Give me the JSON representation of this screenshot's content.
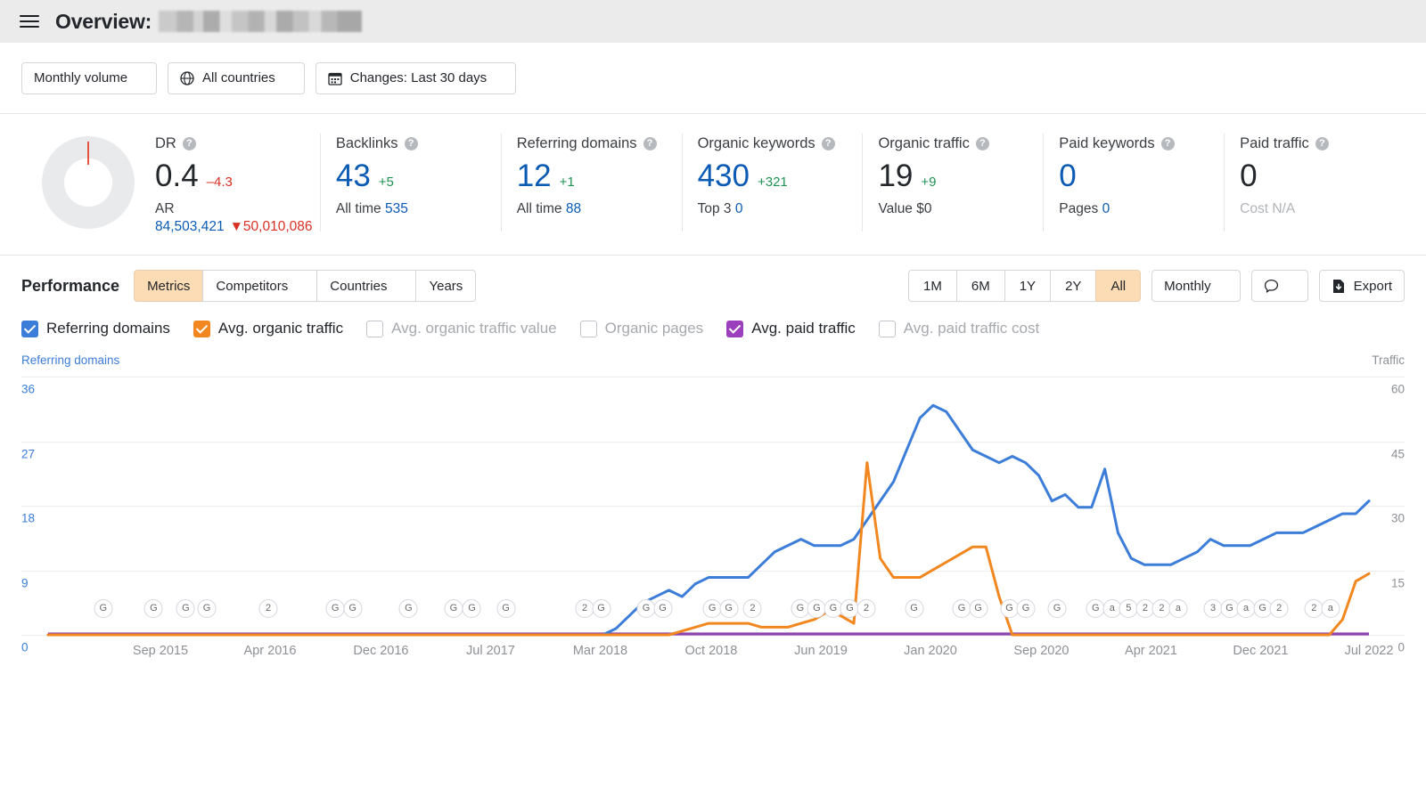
{
  "header": {
    "menu_icon": "hamburger-icon",
    "title": "Overview:",
    "domain_blurred": ""
  },
  "filters": [
    {
      "label": "Monthly volume",
      "icon": ""
    },
    {
      "label": "All countries",
      "icon": "globe-icon"
    },
    {
      "label": "Changes: Last 30 days",
      "icon": "calendar-icon"
    }
  ],
  "metrics": {
    "dr": {
      "label": "DR",
      "value": "0.4",
      "delta": "–4.3",
      "delta_dir": "down",
      "sub_label": "AR",
      "ar_value": "84,503,421",
      "ar_delta": "50,010,086",
      "ar_delta_dir": "down"
    },
    "backlinks": {
      "label": "Backlinks",
      "value": "43",
      "delta": "+5",
      "delta_dir": "up",
      "sub_label": "All time",
      "sub_value": "535"
    },
    "referring_domains": {
      "label": "Referring domains",
      "value": "12",
      "delta": "+1",
      "delta_dir": "up",
      "sub_label": "All time",
      "sub_value": "88"
    },
    "organic_keywords": {
      "label": "Organic keywords",
      "value": "430",
      "delta": "+321",
      "delta_dir": "up",
      "sub_label": "Top 3",
      "sub_value": "0"
    },
    "organic_traffic": {
      "label": "Organic traffic",
      "value": "19",
      "delta": "+9",
      "delta_dir": "up",
      "sub_label": "Value",
      "sub_value": "$0"
    },
    "paid_keywords": {
      "label": "Paid keywords",
      "value": "0",
      "delta": "",
      "sub_label": "Pages",
      "sub_value": "0"
    },
    "paid_traffic": {
      "label": "Paid traffic",
      "value": "0",
      "delta": "",
      "sub_label": "Cost",
      "sub_value": "N/A"
    },
    "help_icon": "question-mark-icon"
  },
  "performance": {
    "title": "Performance",
    "tabs": [
      {
        "label": "Metrics",
        "active": true,
        "caret": false
      },
      {
        "label": "Competitors",
        "active": false,
        "caret": true
      },
      {
        "label": "Countries",
        "active": false,
        "caret": true
      },
      {
        "label": "Years",
        "active": false,
        "caret": false
      }
    ],
    "ranges": [
      {
        "label": "1M",
        "active": false
      },
      {
        "label": "6M",
        "active": false
      },
      {
        "label": "1Y",
        "active": false
      },
      {
        "label": "2Y",
        "active": false
      },
      {
        "label": "All",
        "active": true
      }
    ],
    "granularity": "Monthly",
    "annotations_icon": "speech-bubble-icon",
    "export_label": "Export",
    "export_icon": "download-icon"
  },
  "legend": [
    {
      "label": "Referring domains",
      "checked": true,
      "color": "#3b7dd8"
    },
    {
      "label": "Avg. organic traffic",
      "checked": true,
      "color": "#f2871f"
    },
    {
      "label": "Avg. organic traffic value",
      "checked": false,
      "color": ""
    },
    {
      "label": "Organic pages",
      "checked": false,
      "color": ""
    },
    {
      "label": "Avg. paid traffic",
      "checked": true,
      "color": "#9c3fbd"
    },
    {
      "label": "Avg. paid traffic cost",
      "checked": false,
      "color": ""
    }
  ],
  "chart_data": {
    "type": "line",
    "title": "",
    "left_axis_title": "Referring domains",
    "right_axis_title": "Traffic",
    "left_ticks": [
      "36",
      "27",
      "18",
      "9",
      "0"
    ],
    "right_ticks": [
      "60",
      "45",
      "30",
      "15",
      "0"
    ],
    "left_ylim": [
      0,
      40.5
    ],
    "right_ylim": [
      0,
      67.5
    ],
    "grid": true,
    "legend_position": "top",
    "xlabels": [
      "Sep 2015",
      "Apr 2016",
      "Dec 2016",
      "Jul 2017",
      "Mar 2018",
      "Oct 2018",
      "Jun 2019",
      "Jan 2020",
      "Sep 2020",
      "Apr 2021",
      "Dec 2021",
      "Jul 2022"
    ],
    "xlabel_positions": [
      8.5,
      16.8,
      25.2,
      33.5,
      41.8,
      50.2,
      58.5,
      66.8,
      75.2,
      83.5,
      91.8,
      100.0
    ],
    "series": [
      {
        "name": "Referring domains",
        "color": "#3b7dd8",
        "axis": "left",
        "values": [
          0,
          0,
          0,
          0,
          0,
          0,
          0,
          0,
          0,
          0,
          0,
          0,
          0,
          0,
          0,
          0,
          0,
          0,
          0,
          0,
          0,
          0,
          0,
          0,
          0,
          0,
          0,
          0,
          0,
          0,
          0,
          0,
          0,
          0,
          0,
          0,
          0,
          0,
          0,
          0,
          0,
          0,
          0,
          1,
          3,
          5,
          6,
          7,
          6,
          8,
          9,
          9,
          9,
          9,
          11,
          13,
          14,
          15,
          14,
          14,
          14,
          15,
          18,
          21,
          24,
          29,
          34,
          36,
          35,
          32,
          29,
          28,
          27,
          28,
          27,
          25,
          21,
          22,
          20,
          20,
          26,
          16,
          12,
          11,
          11,
          11,
          12,
          13,
          15,
          14,
          14,
          14,
          15,
          16,
          16,
          16,
          17,
          18,
          19,
          19,
          21
        ]
      },
      {
        "name": "Avg. organic traffic",
        "color": "#f2871f",
        "axis": "right",
        "values": [
          0,
          0,
          0,
          0,
          0,
          0,
          0,
          0,
          0,
          0,
          0,
          0,
          0,
          0,
          0,
          0,
          0,
          0,
          0,
          0,
          0,
          0,
          0,
          0,
          0,
          0,
          0,
          0,
          0,
          0,
          0,
          0,
          0,
          0,
          0,
          0,
          0,
          0,
          0,
          0,
          0,
          0,
          0,
          0,
          0,
          0,
          0,
          0,
          1,
          2,
          3,
          3,
          3,
          3,
          2,
          2,
          2,
          3,
          4,
          6,
          5,
          3,
          45,
          20,
          15,
          15,
          15,
          17,
          19,
          21,
          23,
          23,
          10,
          0,
          0,
          0,
          0,
          0,
          0,
          0,
          0,
          0,
          0,
          0,
          0,
          0,
          0,
          0,
          0,
          0,
          0,
          0,
          0,
          0,
          0,
          0,
          0,
          0,
          4,
          14,
          16
        ]
      },
      {
        "name": "Avg. paid traffic",
        "color": "#9c3fbd",
        "axis": "right",
        "values": [
          0,
          0,
          0,
          0,
          0,
          0,
          0,
          0,
          0,
          0,
          0,
          0,
          0,
          0,
          0,
          0,
          0,
          0,
          0,
          0,
          0,
          0,
          0,
          0,
          0,
          0,
          0,
          0,
          0,
          0,
          0,
          0,
          0,
          0,
          0,
          0,
          0,
          0,
          0,
          0,
          0,
          0,
          0,
          0,
          0,
          0,
          0,
          0,
          0,
          0,
          0,
          0,
          0,
          0,
          0,
          0,
          0,
          0,
          0,
          0,
          0,
          0,
          0,
          0,
          0,
          0,
          0,
          0,
          0,
          0,
          0,
          0,
          0,
          0,
          0,
          0,
          0,
          0,
          0,
          0,
          0,
          0,
          0,
          0,
          0,
          0,
          0,
          0,
          0,
          0,
          0,
          0,
          0,
          0,
          0,
          0,
          0,
          0,
          0,
          0,
          0
        ]
      }
    ],
    "annotations": [
      {
        "x": 6.0,
        "label": "G"
      },
      {
        "x": 11.5,
        "label": "G"
      },
      {
        "x": 15.0,
        "label": "G"
      },
      {
        "x": 17.3,
        "label": "G"
      },
      {
        "x": 24.0,
        "label": "2"
      },
      {
        "x": 31.3,
        "label": "G"
      },
      {
        "x": 33.2,
        "label": "G"
      },
      {
        "x": 39.3,
        "label": "G"
      },
      {
        "x": 44.2,
        "label": "G"
      },
      {
        "x": 46.2,
        "label": "G"
      },
      {
        "x": 49.9,
        "label": "G"
      },
      {
        "x": 58.5,
        "label": "2"
      },
      {
        "x": 60.3,
        "label": "G"
      },
      {
        "x": 65.2,
        "label": "G"
      },
      {
        "x": 67.0,
        "label": "G"
      },
      {
        "x": 72.4,
        "label": "G"
      },
      {
        "x": 74.2,
        "label": "G"
      },
      {
        "x": 76.8,
        "label": "2"
      },
      {
        "x": 82.0,
        "label": "G"
      },
      {
        "x": 83.8,
        "label": "G"
      },
      {
        "x": 85.6,
        "label": "G"
      },
      {
        "x": 87.4,
        "label": "G"
      },
      {
        "x": 89.2,
        "label": "2"
      },
      {
        "x": 94.4,
        "label": "G"
      },
      {
        "x": 99.6,
        "label": "G"
      },
      {
        "x": 101.4,
        "label": "G"
      },
      {
        "x": 104.8,
        "label": "G"
      },
      {
        "x": 106.6,
        "label": "G"
      },
      {
        "x": 110.0,
        "label": "G"
      },
      {
        "x": 114.2,
        "label": "G"
      },
      {
        "x": 116.0,
        "label": "a"
      },
      {
        "x": 117.8,
        "label": "5"
      },
      {
        "x": 119.6,
        "label": "2"
      },
      {
        "x": 121.4,
        "label": "2"
      },
      {
        "x": 123.2,
        "label": "a"
      },
      {
        "x": 127.0,
        "label": "3"
      },
      {
        "x": 128.8,
        "label": "G"
      },
      {
        "x": 130.6,
        "label": "a"
      },
      {
        "x": 132.4,
        "label": "G"
      },
      {
        "x": 134.2,
        "label": "2"
      },
      {
        "x": 138.0,
        "label": "2"
      },
      {
        "x": 139.8,
        "label": "a"
      }
    ]
  }
}
